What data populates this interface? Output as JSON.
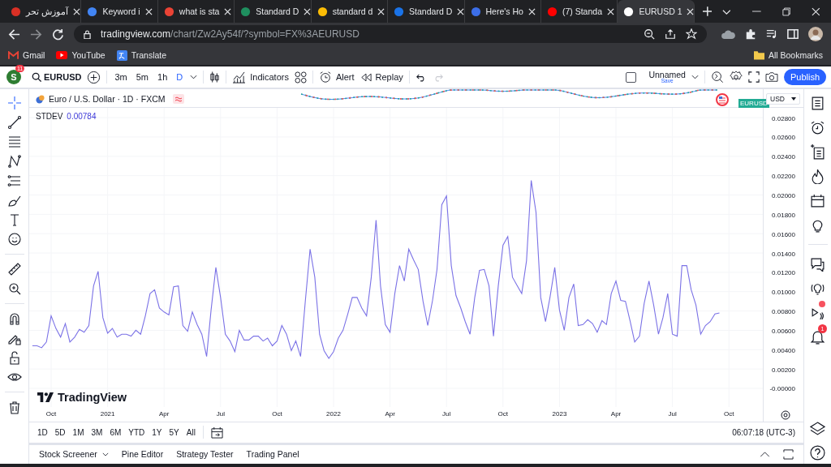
{
  "browser": {
    "tabs": [
      {
        "title": "آموزش تحر",
        "selected": false
      },
      {
        "title": "Keyword i",
        "selected": false
      },
      {
        "title": "what is sta",
        "selected": false
      },
      {
        "title": "Standard D",
        "selected": false
      },
      {
        "title": "standard d",
        "selected": false
      },
      {
        "title": "Standard D",
        "selected": false
      },
      {
        "title": "Here's Ho",
        "selected": false
      },
      {
        "title": "(7) Standa",
        "selected": false
      },
      {
        "title": "EURUSD 1",
        "selected": true
      }
    ],
    "url_host": "tradingview.com",
    "url_path": "/chart/Zw2Ay54f/?symbol=FX%3AEURUSD",
    "bookmarks": [
      "Gmail",
      "YouTube",
      "Translate"
    ],
    "all_bookmarks": "All Bookmarks"
  },
  "toolbar": {
    "avatar": "S",
    "avatar_badge": "11",
    "symbol": "EURUSD",
    "intervals": [
      {
        "label": "3m",
        "selected": false
      },
      {
        "label": "5m",
        "selected": false
      },
      {
        "label": "1h",
        "selected": false
      },
      {
        "label": "D",
        "selected": true
      }
    ],
    "indicators": "Indicators",
    "alert": "Alert",
    "replay": "Replay",
    "history": [
      {
        "disabled": false
      },
      {
        "disabled": true
      }
    ],
    "layout_checkbox": {
      "checked": false
    },
    "layout_name": "Unnamed",
    "layout_status": "Save",
    "publish": "Publish"
  },
  "tools": [
    {
      "selected": true
    },
    {
      "selected": false
    },
    {
      "selected": false
    },
    {
      "selected": false
    },
    {
      "selected": false
    },
    {
      "selected": false
    },
    {
      "selected": false
    },
    {
      "selected": false
    },
    {
      "selected": false
    },
    {
      "selected": false
    },
    {
      "selected": false
    },
    {
      "selected": false
    },
    {
      "selected": false
    },
    {
      "selected": false
    },
    {
      "selected": false
    }
  ],
  "chart": {
    "legend": "Euro / U.S. Dollar · 1D · FXCM",
    "symbol_badge": "EURUSD",
    "currency": "USD",
    "indicator_value": "0.00784",
    "logo": "TradingView",
    "chart_data": {
      "type": "line",
      "grid": true,
      "xlim": [
        2020.653,
        2023.9
      ],
      "ylim": [
        -0.00193,
        0.0291
      ],
      "xticks": [
        {
          "value": 2020.75,
          "label": "Oct"
        },
        {
          "value": 2021,
          "label": "2021"
        },
        {
          "value": 2021.25,
          "label": "Apr"
        },
        {
          "value": 2021.5,
          "label": "Jul"
        },
        {
          "value": 2021.75,
          "label": "Oct"
        },
        {
          "value": 2022,
          "label": "2022"
        },
        {
          "value": 2022.25,
          "label": "Apr"
        },
        {
          "value": 2022.5,
          "label": "Jul"
        },
        {
          "value": 2022.75,
          "label": "Oct"
        },
        {
          "value": 2023,
          "label": "2023"
        },
        {
          "value": 2023.25,
          "label": "Apr"
        },
        {
          "value": 2023.5,
          "label": "Jul"
        },
        {
          "value": 2023.75,
          "label": "Oct"
        }
      ],
      "yticks": [
        {
          "value": 0,
          "label": "-0.00000"
        },
        {
          "value": 0.002,
          "label": "0.00200"
        },
        {
          "value": 0.004,
          "label": "0.00400"
        },
        {
          "value": 0.006,
          "label": "0.00600"
        },
        {
          "value": 0.008,
          "label": "0.00800"
        },
        {
          "value": 0.01,
          "label": "0.01000"
        },
        {
          "value": 0.012,
          "label": "0.01200"
        },
        {
          "value": 0.014,
          "label": "0.01400"
        },
        {
          "value": 0.016,
          "label": "0.01600"
        },
        {
          "value": 0.018,
          "label": "0.01800"
        },
        {
          "value": 0.02,
          "label": "0.02000"
        },
        {
          "value": 0.022,
          "label": "0.02200"
        },
        {
          "value": 0.024,
          "label": "0.02400"
        },
        {
          "value": 0.026,
          "label": "0.02600"
        },
        {
          "value": 0.028,
          "label": "0.02800"
        }
      ],
      "x": [
        2020.667,
        2020.688,
        2020.708,
        2020.729,
        2020.75,
        2020.771,
        2020.792,
        2020.813,
        2020.833,
        2020.854,
        2020.875,
        2020.896,
        2020.917,
        2020.938,
        2020.958,
        2020.979,
        2021,
        2021.021,
        2021.042,
        2021.063,
        2021.083,
        2021.104,
        2021.125,
        2021.146,
        2021.167,
        2021.188,
        2021.208,
        2021.229,
        2021.25,
        2021.271,
        2021.292,
        2021.313,
        2021.333,
        2021.354,
        2021.375,
        2021.396,
        2021.417,
        2021.438,
        2021.458,
        2021.479,
        2021.5,
        2021.521,
        2021.542,
        2021.563,
        2021.583,
        2021.604,
        2021.625,
        2021.646,
        2021.667,
        2021.688,
        2021.708,
        2021.729,
        2021.75,
        2021.771,
        2021.792,
        2021.813,
        2021.833,
        2021.854,
        2021.875,
        2021.896,
        2021.917,
        2021.938,
        2021.958,
        2021.979,
        2022,
        2022.021,
        2022.042,
        2022.063,
        2022.083,
        2022.104,
        2022.125,
        2022.146,
        2022.167,
        2022.188,
        2022.208,
        2022.229,
        2022.25,
        2022.271,
        2022.292,
        2022.313,
        2022.333,
        2022.354,
        2022.375,
        2022.396,
        2022.417,
        2022.438,
        2022.458,
        2022.479,
        2022.5,
        2022.521,
        2022.542,
        2022.563,
        2022.583,
        2022.604,
        2022.625,
        2022.646,
        2022.667,
        2022.688,
        2022.708,
        2022.729,
        2022.75,
        2022.771,
        2022.792,
        2022.813,
        2022.833,
        2022.854,
        2022.875,
        2022.896,
        2022.917,
        2022.938,
        2022.958,
        2022.979,
        2023,
        2023.021,
        2023.042,
        2023.063,
        2023.083,
        2023.104,
        2023.125,
        2023.146,
        2023.167,
        2023.188,
        2023.208,
        2023.229,
        2023.25,
        2023.271,
        2023.292,
        2023.313,
        2023.333,
        2023.354,
        2023.375,
        2023.396,
        2023.417,
        2023.438,
        2023.458,
        2023.479,
        2023.5,
        2023.521,
        2023.542,
        2023.563,
        2023.583,
        2023.604,
        2023.625,
        2023.646,
        2023.667,
        2023.688,
        2023.708
      ],
      "series": [
        {
          "name": "STDEV",
          "color": "#7b72e6",
          "values": [
            0.0044,
            0.0044,
            0.0042,
            0.0048,
            0.0075,
            0.0062,
            0.0053,
            0.0067,
            0.0048,
            0.0053,
            0.0061,
            0.0058,
            0.0065,
            0.0106,
            0.0121,
            0.0073,
            0.0057,
            0.0062,
            0.0053,
            0.0056,
            0.0056,
            0.0054,
            0.006,
            0.0056,
            0.0075,
            0.0098,
            0.0102,
            0.0083,
            0.0079,
            0.0076,
            0.0105,
            0.0106,
            0.0065,
            0.0059,
            0.0079,
            0.0066,
            0.0056,
            0.0033,
            0.0081,
            0.0125,
            0.0094,
            0.0056,
            0.0049,
            0.0038,
            0.006,
            0.005,
            0.005,
            0.0054,
            0.0054,
            0.0049,
            0.0052,
            0.0044,
            0.0049,
            0.0065,
            0.0056,
            0.0039,
            0.0049,
            0.0033,
            0.009,
            0.0144,
            0.0115,
            0.0056,
            0.0039,
            0.0031,
            0.0038,
            0.0052,
            0.006,
            0.0077,
            0.0094,
            0.0094,
            0.0083,
            0.0075,
            0.0115,
            0.0174,
            0.0106,
            0.0066,
            0.0058,
            0.0098,
            0.0127,
            0.0111,
            0.0144,
            0.0133,
            0.0123,
            0.009,
            0.0065,
            0.0091,
            0.0123,
            0.019,
            0.0199,
            0.0127,
            0.0096,
            0.0083,
            0.0069,
            0.0056,
            0.0094,
            0.0122,
            0.0123,
            0.0106,
            0.0054,
            0.0106,
            0.0148,
            0.0157,
            0.0115,
            0.0106,
            0.0098,
            0.0132,
            0.0215,
            0.0182,
            0.0094,
            0.0069,
            0.0094,
            0.0125,
            0.0081,
            0.006,
            0.0094,
            0.0108,
            0.0065,
            0.0066,
            0.0071,
            0.0067,
            0.0058,
            0.007,
            0.0066,
            0.0098,
            0.0111,
            0.0091,
            0.009,
            0.0069,
            0.0048,
            0.0054,
            0.0088,
            0.0111,
            0.0086,
            0.0056,
            0.0073,
            0.0098,
            0.0056,
            0.0054,
            0.0127,
            0.0127,
            0.0102,
            0.0086,
            0.0056,
            0.0065,
            0.0069,
            0.0077,
            0.0078
          ]
        }
      ]
    }
  },
  "range_bar": {
    "ranges": [
      "1D",
      "5D",
      "1M",
      "3M",
      "6M",
      "YTD",
      "1Y",
      "5Y",
      "All"
    ],
    "clock": "06:07:18 (UTC-3)"
  },
  "bottom_panel": {
    "tabs": [
      {
        "label": "Stock Screener",
        "has_menu": true
      },
      {
        "label": "Pine Editor",
        "has_menu": false
      },
      {
        "label": "Strategy Tester",
        "has_menu": false
      },
      {
        "label": "Trading Panel",
        "has_menu": false
      }
    ]
  },
  "sidebar": {
    "notifications_badge": "1"
  }
}
